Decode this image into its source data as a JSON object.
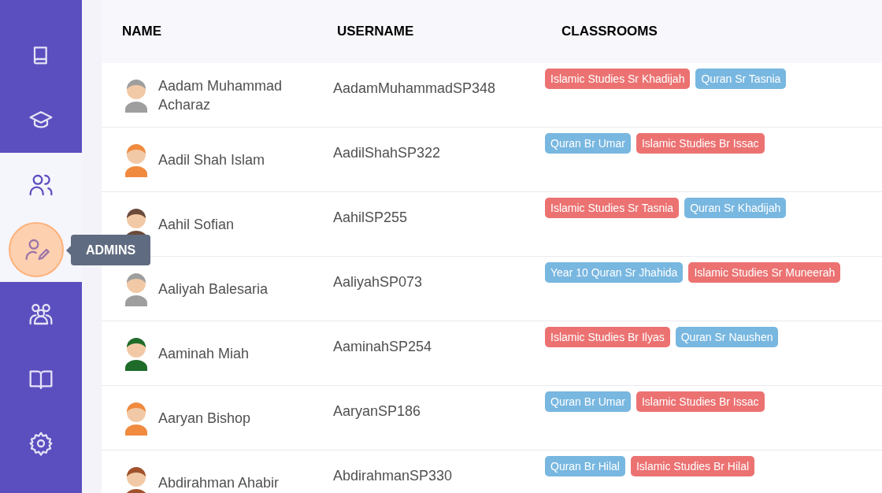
{
  "sidebar": {
    "items": [
      {
        "selected": false,
        "highlighted": false
      },
      {
        "selected": false,
        "highlighted": false
      },
      {
        "selected": true,
        "highlighted": false
      },
      {
        "selected": true,
        "highlighted": true,
        "tooltip": "ADMINS"
      },
      {
        "selected": false,
        "highlighted": false
      },
      {
        "selected": false,
        "highlighted": false
      },
      {
        "selected": false,
        "highlighted": false
      }
    ]
  },
  "table": {
    "columns": [
      "NAME",
      "USERNAME",
      "CLASSROOMS"
    ],
    "rows": [
      {
        "avatar": {
          "color": "#9e9e9e"
        },
        "name": "Aadam Muhammad Acharaz",
        "username": "AadamMuhammadSP348",
        "classrooms": [
          {
            "label": "Islamic Studies Sr Khadijah",
            "color": "#ec7272"
          },
          {
            "label": "Quran Sr Tasnia",
            "color": "#78b7e0"
          }
        ]
      },
      {
        "avatar": {
          "color": "#f08a3e"
        },
        "name": "Aadil Shah Islam",
        "username": "AadilShahSP322",
        "classrooms": [
          {
            "label": "Quran Br Umar",
            "color": "#78b7e0"
          },
          {
            "label": "Islamic Studies Br Issac",
            "color": "#ec7272"
          }
        ]
      },
      {
        "avatar": {
          "color": "#6b4a3a"
        },
        "name": "Aahil Sofian",
        "username": "AahilSP255",
        "classrooms": [
          {
            "label": "Islamic Studies Sr Tasnia",
            "color": "#ec7272"
          },
          {
            "label": "Quran Sr Khadijah",
            "color": "#78b7e0"
          }
        ]
      },
      {
        "avatar": {
          "color": "#9e9e9e"
        },
        "name": "Aaliyah Balesaria",
        "username": "AaliyahSP073",
        "classrooms": [
          {
            "label": "Year 10 Quran Sr Jhahida",
            "color": "#78b7e0"
          },
          {
            "label": "Islamic Studies Sr Muneerah",
            "color": "#ec7272"
          }
        ]
      },
      {
        "avatar": {
          "color": "#1f6b2a"
        },
        "name": "Aaminah Miah",
        "username": "AaminahSP254",
        "classrooms": [
          {
            "label": "Islamic Studies Br Ilyas",
            "color": "#ec7272"
          },
          {
            "label": "Quran Sr Naushen",
            "color": "#78b7e0"
          }
        ]
      },
      {
        "avatar": {
          "color": "#f08a3e"
        },
        "name": "Aaryan Bishop",
        "username": "AaryanSP186",
        "classrooms": [
          {
            "label": "Quran Br Umar",
            "color": "#78b7e0"
          },
          {
            "label": "Islamic Studies Br Issac",
            "color": "#ec7272"
          }
        ]
      },
      {
        "avatar": {
          "color": "#a0522d"
        },
        "name": "Abdirahman Ahabir",
        "username": "AbdirahmanSP330",
        "classrooms": [
          {
            "label": "Quran Br Hilal",
            "color": "#78b7e0"
          },
          {
            "label": "Islamic Studies Br Hilal",
            "color": "#ec7272"
          }
        ]
      }
    ]
  }
}
